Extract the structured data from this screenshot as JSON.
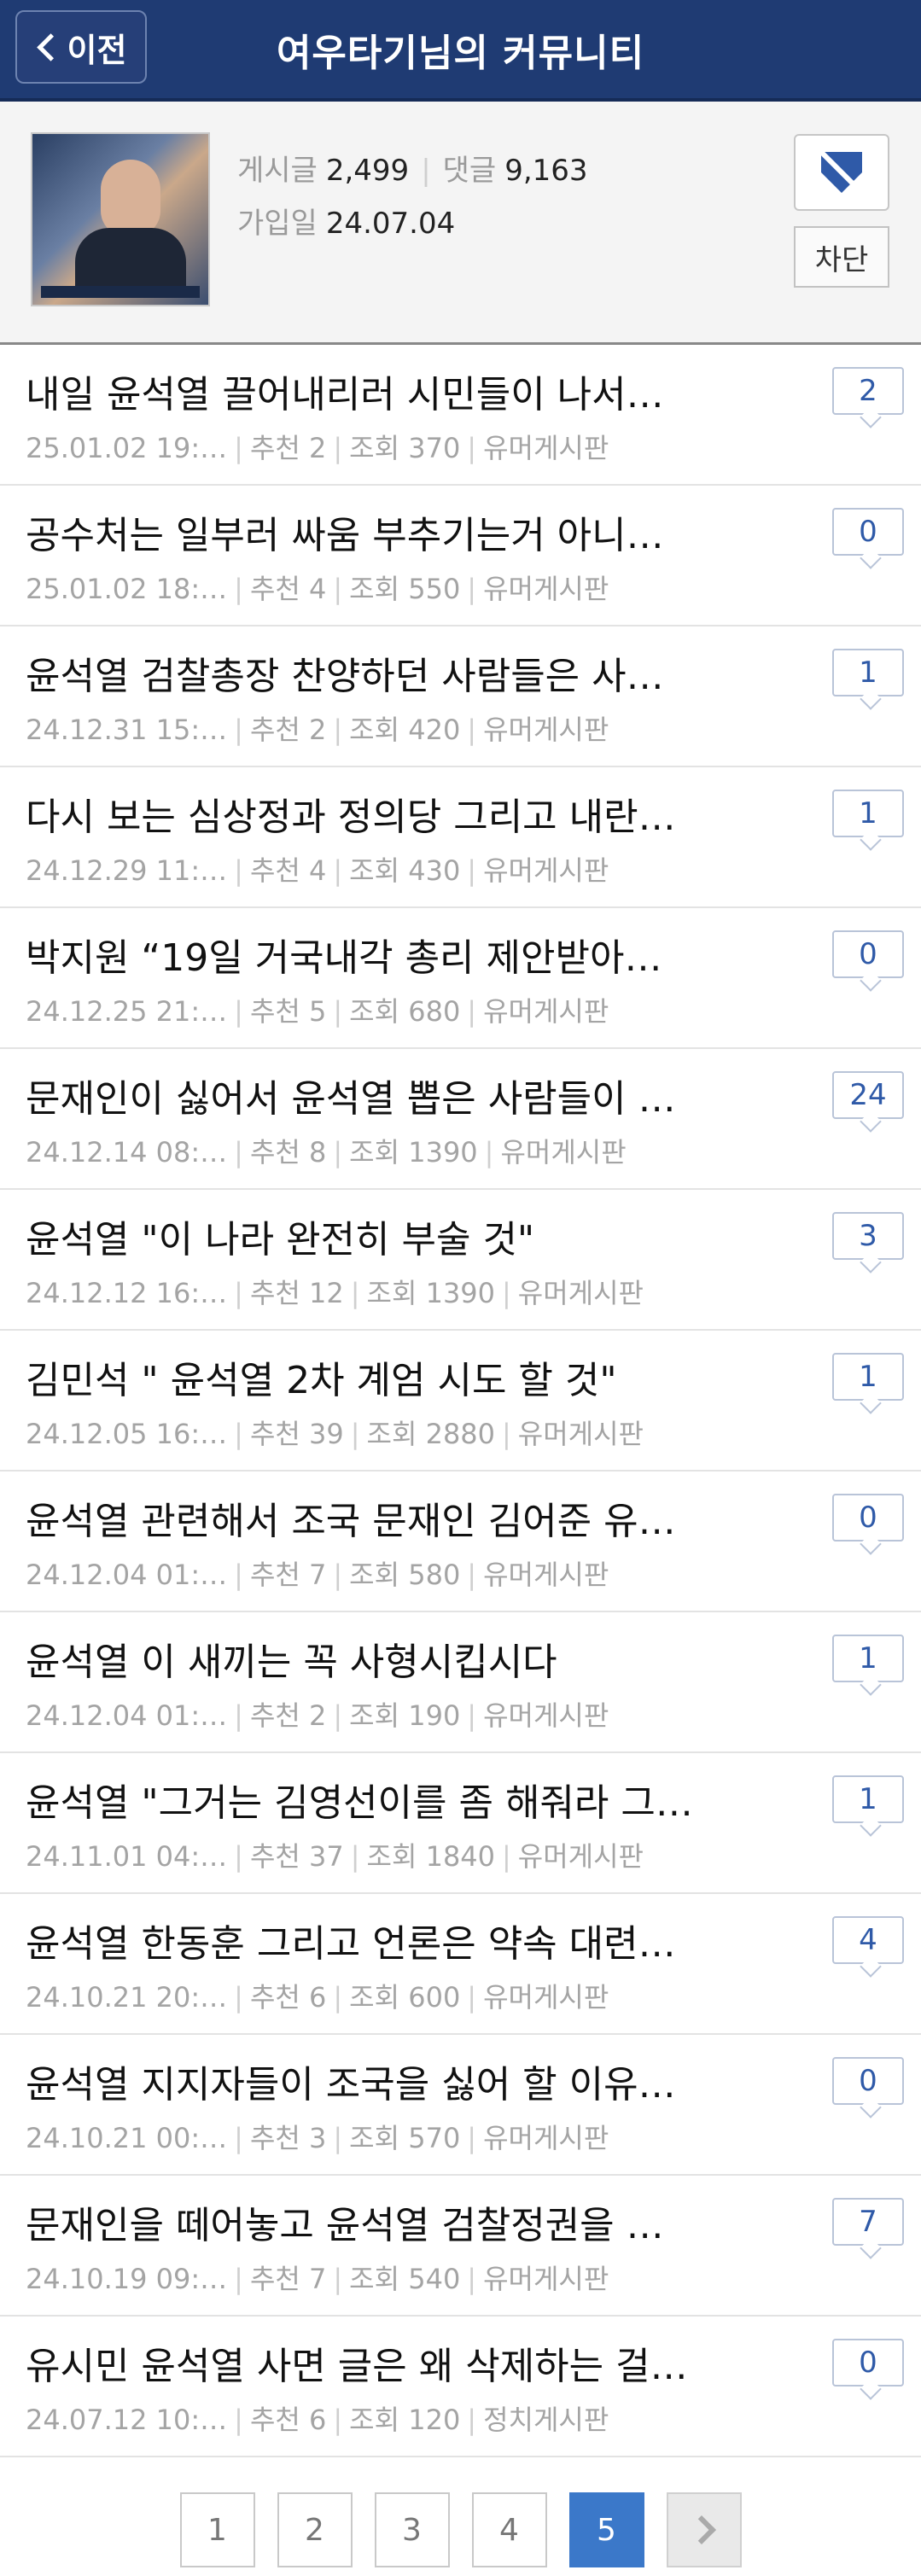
{
  "header": {
    "back_label": "이전",
    "title": "여우타기님의 커뮤니티"
  },
  "profile": {
    "posts_label": "게시글",
    "posts_value": "2,499",
    "comments_label": "댓글",
    "comments_value": "9,163",
    "joined_label": "가입일",
    "joined_value": "24.07.04",
    "block_label": "차단"
  },
  "labels": {
    "recommend": "추천",
    "views": "조회"
  },
  "posts": [
    {
      "title": "내일 윤석열 끌어내리러 시민들이 나서…",
      "date": "25.01.02  19:…",
      "rec": "2",
      "views": "370",
      "board": "유머게시판",
      "comments": "2"
    },
    {
      "title": "공수처는 일부러 싸움 부추기는거 아니…",
      "date": "25.01.02  18:…",
      "rec": "4",
      "views": "550",
      "board": "유머게시판",
      "comments": "0"
    },
    {
      "title": "윤석열 검찰총장 찬양하던 사람들은 사…",
      "date": "24.12.31  15:…",
      "rec": "2",
      "views": "420",
      "board": "유머게시판",
      "comments": "1"
    },
    {
      "title": "다시 보는 심상정과 정의당 그리고 내란…",
      "date": "24.12.29  11:…",
      "rec": "4",
      "views": "430",
      "board": "유머게시판",
      "comments": "1"
    },
    {
      "title": "박지원 “19일 거국내각 총리 제안받아…",
      "date": "24.12.25  21:…",
      "rec": "5",
      "views": "680",
      "board": "유머게시판",
      "comments": "0"
    },
    {
      "title": "문재인이 싫어서 윤석열 뽑은 사람들이 …",
      "date": "24.12.14  08:…",
      "rec": "8",
      "views": "1390",
      "board": "유머게시판",
      "comments": "24"
    },
    {
      "title": "윤석열 \"이 나라 완전히 부술 것\"",
      "date": "24.12.12  16:…",
      "rec": "12",
      "views": "1390",
      "board": "유머게시판",
      "comments": "3"
    },
    {
      "title": "김민석 \" 윤석열 2차 계엄 시도 할 것\"",
      "date": "24.12.05  16:…",
      "rec": "39",
      "views": "2880",
      "board": "유머게시판",
      "comments": "1"
    },
    {
      "title": "윤석열 관련해서 조국 문재인 김어준 유…",
      "date": "24.12.04  01:…",
      "rec": "7",
      "views": "580",
      "board": "유머게시판",
      "comments": "0"
    },
    {
      "title": "윤석열 이 새끼는 꼭 사형시킵시다",
      "date": "24.12.04  01:…",
      "rec": "2",
      "views": "190",
      "board": "유머게시판",
      "comments": "1"
    },
    {
      "title": "윤석열 \"그거는 김영선이를 좀 해줘라 그…",
      "date": "24.11.01  04:…",
      "rec": "37",
      "views": "1840",
      "board": "유머게시판",
      "comments": "1"
    },
    {
      "title": "윤석열 한동훈 그리고 언론은 약속 대련…",
      "date": "24.10.21  20:…",
      "rec": "6",
      "views": "600",
      "board": "유머게시판",
      "comments": "4"
    },
    {
      "title": "윤석열 지지자들이 조국을 싫어 할 이유…",
      "date": "24.10.21  00:…",
      "rec": "3",
      "views": "570",
      "board": "유머게시판",
      "comments": "0"
    },
    {
      "title": "문재인을 떼어놓고 윤석열 검찰정권을 …",
      "date": "24.10.19  09:…",
      "rec": "7",
      "views": "540",
      "board": "유머게시판",
      "comments": "7"
    },
    {
      "title": "유시민 윤석열 사면 글은 왜 삭제하는 걸…",
      "date": "24.07.12  10:…",
      "rec": "6",
      "views": "120",
      "board": "정치게시판",
      "comments": "0"
    }
  ],
  "pagination": {
    "pages": [
      "1",
      "2",
      "3",
      "4",
      "5"
    ],
    "current": "5"
  },
  "colors": {
    "header_bg": "#1f3b73",
    "accent": "#3b78c9",
    "comment_count": "#2f5aa8"
  }
}
